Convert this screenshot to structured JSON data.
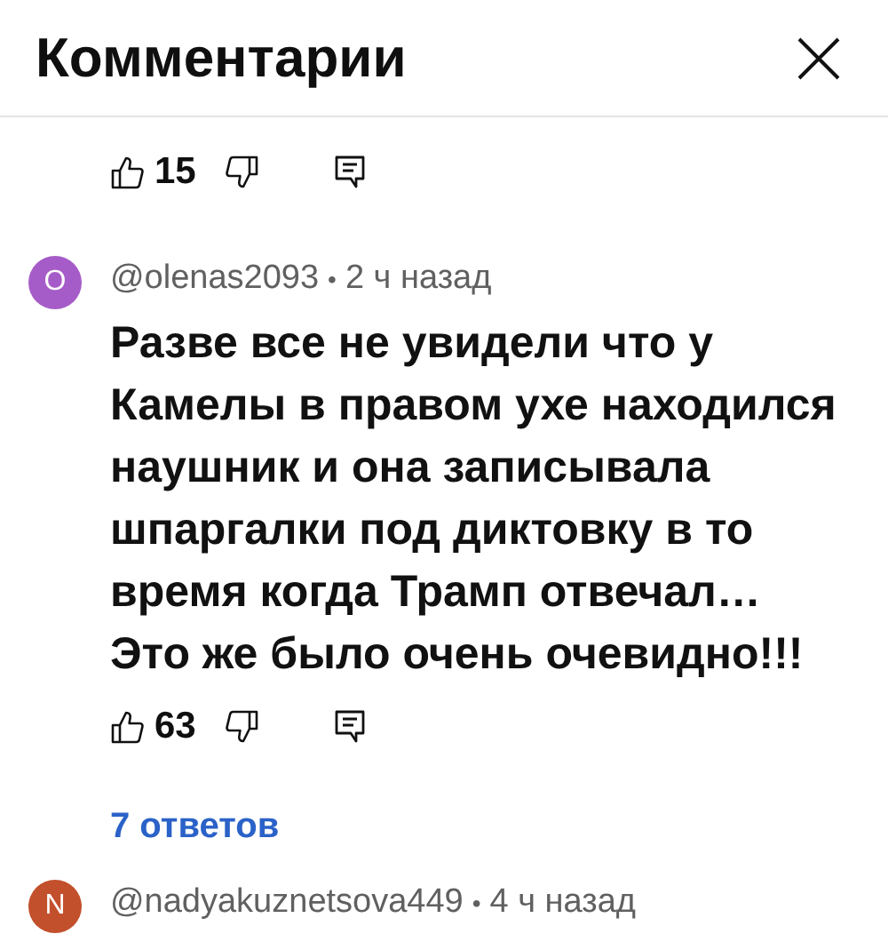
{
  "header": {
    "title": "Комментарии"
  },
  "comments": [
    {
      "likes": "15"
    },
    {
      "avatar_letter": "O",
      "color": "#a65cc8",
      "author": "@olenas2093",
      "separator": "•",
      "time": "2 ч назад",
      "text": "Разве все не увидели что у Камелы в правом ухе находился наушник и она записывала шпаргалки под диктовку в то время когда Трамп отвечал… Это же было очень очевидно!!!",
      "likes": "63",
      "replies": "7 ответов"
    },
    {
      "avatar_letter": "N",
      "color": "#c2502c",
      "author": "@nadyakuznetsova449",
      "separator": "•",
      "time": "4 ч назад"
    }
  ]
}
